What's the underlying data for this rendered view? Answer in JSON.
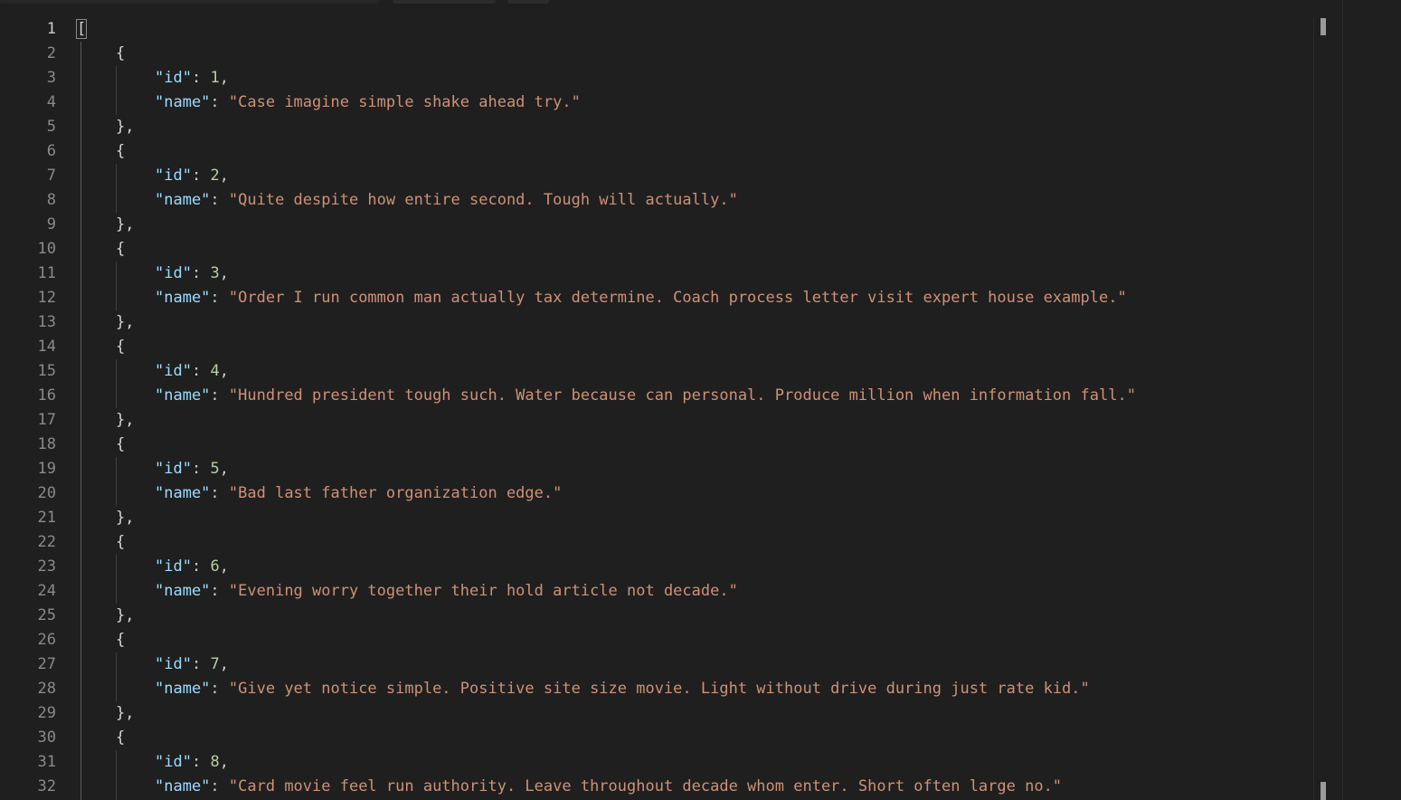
{
  "editor": {
    "language": "json",
    "colors": {
      "background": "#1f1f1f",
      "line_number": "#8a8a8a",
      "key": "#9cdcfe",
      "number": "#b5cea8",
      "string": "#ce9178",
      "punctuation": "#cccccc"
    },
    "line_numbers": [
      "1",
      "2",
      "3",
      "4",
      "5",
      "6",
      "7",
      "8",
      "9",
      "10",
      "11",
      "12",
      "13",
      "14",
      "15",
      "16",
      "17",
      "18",
      "19",
      "20",
      "21",
      "22",
      "23",
      "24",
      "25",
      "26",
      "27",
      "28",
      "29",
      "30",
      "31",
      "32"
    ],
    "open_bracket": "[",
    "item_open": "{",
    "item_close": "},",
    "key_id": "\"id\"",
    "key_name": "\"name\"",
    "colon": ": ",
    "comma": ",",
    "items": [
      {
        "id": "1",
        "name": "\"Case imagine simple shake ahead try.\""
      },
      {
        "id": "2",
        "name": "\"Quite despite how entire second. Tough will actually.\""
      },
      {
        "id": "3",
        "name": "\"Order I run common man actually tax determine. Coach process letter visit expert house example.\""
      },
      {
        "id": "4",
        "name": "\"Hundred president tough such. Water because can personal. Produce million when information fall.\""
      },
      {
        "id": "5",
        "name": "\"Bad last father organization edge.\""
      },
      {
        "id": "6",
        "name": "\"Evening worry together their hold article not decade.\""
      },
      {
        "id": "7",
        "name": "\"Give yet notice simple. Positive site size movie. Light without drive during just rate kid.\""
      },
      {
        "id": "8",
        "name": "\"Card movie feel run authority. Leave throughout decade whom enter. Short often large no.\""
      }
    ]
  }
}
